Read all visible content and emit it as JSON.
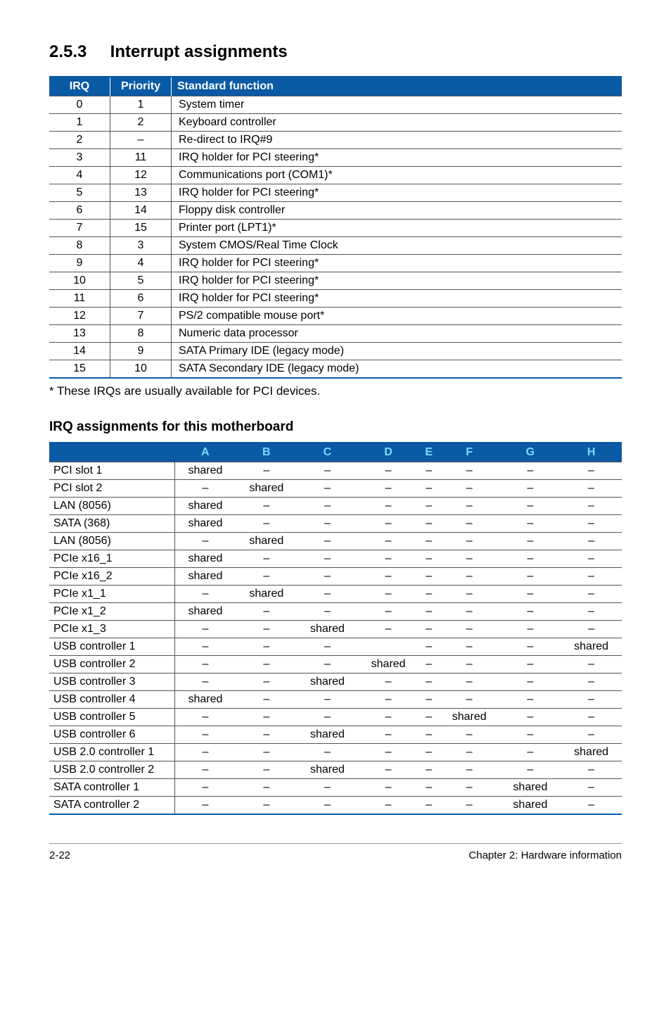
{
  "section": {
    "number": "2.5.3",
    "title": "Interrupt assignments"
  },
  "irq_table": {
    "headers": {
      "irq": "IRQ",
      "priority": "Priority",
      "func": "Standard function"
    },
    "rows": [
      {
        "irq": "0",
        "priority": "1",
        "func": "System timer"
      },
      {
        "irq": "1",
        "priority": "2",
        "func": "Keyboard controller"
      },
      {
        "irq": "2",
        "priority": "–",
        "func": "Re-direct to IRQ#9"
      },
      {
        "irq": "3",
        "priority": "11",
        "func": "IRQ holder for PCI steering*"
      },
      {
        "irq": "4",
        "priority": "12",
        "func": "Communications port (COM1)*"
      },
      {
        "irq": "5",
        "priority": "13",
        "func": "IRQ holder for PCI steering*"
      },
      {
        "irq": "6",
        "priority": "14",
        "func": "Floppy disk controller"
      },
      {
        "irq": "7",
        "priority": "15",
        "func": "Printer port (LPT1)*"
      },
      {
        "irq": "8",
        "priority": "3",
        "func": "System CMOS/Real Time Clock"
      },
      {
        "irq": "9",
        "priority": "4",
        "func": "IRQ holder for PCI steering*"
      },
      {
        "irq": "10",
        "priority": "5",
        "func": "IRQ holder for PCI steering*"
      },
      {
        "irq": "11",
        "priority": "6",
        "func": "IRQ holder for PCI steering*"
      },
      {
        "irq": "12",
        "priority": "7",
        "func": "PS/2 compatible mouse port*"
      },
      {
        "irq": "13",
        "priority": "8",
        "func": "Numeric data processor"
      },
      {
        "irq": "14",
        "priority": "9",
        "func": "SATA Primary IDE (legacy mode)"
      },
      {
        "irq": "15",
        "priority": "10",
        "func": "SATA Secondary IDE (legacy mode)"
      }
    ]
  },
  "note": "* These IRQs are usually available for PCI devices.",
  "subhead": "IRQ assignments for this motherboard",
  "assign_table": {
    "columns": [
      "A",
      "B",
      "C",
      "D",
      "E",
      "F",
      "G",
      "H"
    ],
    "rows": [
      {
        "label": "PCI slot 1",
        "cells": [
          "shared",
          "–",
          "–",
          "–",
          "–",
          "–",
          "–",
          "–"
        ]
      },
      {
        "label": "PCI slot 2",
        "cells": [
          "–",
          "shared",
          "–",
          "–",
          "–",
          "–",
          "–",
          "–"
        ]
      },
      {
        "label": "LAN (8056)",
        "cells": [
          "shared",
          "–",
          "–",
          "–",
          "–",
          "–",
          "–",
          "–"
        ]
      },
      {
        "label": "SATA (368)",
        "cells": [
          "shared",
          "–",
          "–",
          "–",
          "–",
          "–",
          "–",
          "–"
        ]
      },
      {
        "label": "LAN (8056)",
        "cells": [
          "–",
          "shared",
          "–",
          "–",
          "–",
          "–",
          "–",
          "–"
        ]
      },
      {
        "label": "PCIe x16_1",
        "cells": [
          "shared",
          "–",
          "–",
          "–",
          "–",
          "–",
          "–",
          "–"
        ]
      },
      {
        "label": "PCIe x16_2",
        "cells": [
          "shared",
          "–",
          "–",
          "–",
          "–",
          "–",
          "–",
          "–"
        ]
      },
      {
        "label": "PCIe x1_1",
        "cells": [
          "–",
          "shared",
          "–",
          "–",
          "–",
          "–",
          "–",
          "–"
        ]
      },
      {
        "label": "PCIe x1_2",
        "cells": [
          "shared",
          "–",
          "–",
          "–",
          "–",
          "–",
          "–",
          "–"
        ]
      },
      {
        "label": "PCIe x1_3",
        "cells": [
          "–",
          "–",
          "shared",
          "–",
          "–",
          "–",
          "–",
          "–"
        ]
      },
      {
        "label": "USB controller 1",
        "cells": [
          "–",
          "–",
          "–",
          "",
          "–",
          "–",
          "–",
          "shared"
        ]
      },
      {
        "label": "USB controller 2",
        "cells": [
          "–",
          "–",
          "–",
          "shared",
          "–",
          "–",
          "–",
          "–"
        ]
      },
      {
        "label": "USB controller 3",
        "cells": [
          "–",
          "–",
          "shared",
          "–",
          "–",
          "–",
          "–",
          "–"
        ]
      },
      {
        "label": "USB controller 4",
        "cells": [
          "shared",
          "–",
          "–",
          "–",
          "–",
          "–",
          "–",
          "–"
        ]
      },
      {
        "label": "USB controller 5",
        "cells": [
          "–",
          "–",
          "–",
          "–",
          "–",
          "shared",
          "–",
          "–"
        ]
      },
      {
        "label": "USB controller 6",
        "cells": [
          "–",
          "–",
          "shared",
          "–",
          "–",
          "–",
          "–",
          "–"
        ]
      },
      {
        "label": "USB 2.0 controller 1",
        "cells": [
          "–",
          "–",
          "–",
          "–",
          "–",
          "–",
          "–",
          "shared"
        ]
      },
      {
        "label": "USB 2.0 controller 2",
        "cells": [
          "–",
          "–",
          "shared",
          "–",
          "–",
          "–",
          "–",
          "–"
        ]
      },
      {
        "label": "SATA controller 1",
        "cells": [
          "–",
          "–",
          "–",
          "–",
          "–",
          "–",
          "shared",
          "–"
        ]
      },
      {
        "label": "SATA controller 2",
        "cells": [
          "–",
          "–",
          "–",
          "–",
          "–",
          "–",
          "shared",
          "–"
        ]
      }
    ]
  },
  "footer": {
    "page": "2-22",
    "chapter": "Chapter 2: Hardware information"
  }
}
